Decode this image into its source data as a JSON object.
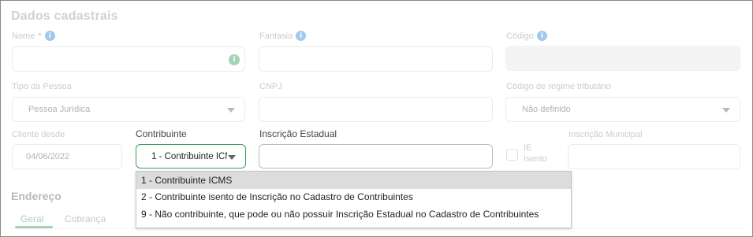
{
  "section_title": "Dados cadastrais",
  "fields": {
    "nome": {
      "label": "Nome",
      "required_mark": "*",
      "value": ""
    },
    "fantasia": {
      "label": "Fantasia",
      "value": ""
    },
    "codigo": {
      "label": "Código",
      "value": ""
    },
    "tipo_pessoa": {
      "label": "Tipo da Pessoa",
      "value": "Pessoa Jurídica"
    },
    "cnpj": {
      "label": "CNPJ",
      "value": ""
    },
    "regime": {
      "label": "Código de regime tributário",
      "value": "Não definido"
    },
    "cliente_desde": {
      "label": "Cliente desde",
      "value": "04/06/2022"
    },
    "contribuinte": {
      "label": "Contribuinte",
      "value": "1 - Contribuinte ICMS"
    },
    "inscricao_estadual": {
      "label": "Inscrição Estadual",
      "value": ""
    },
    "ie_isento": {
      "label_line1": "IE",
      "label_line2": "Isento",
      "checked": false
    },
    "inscricao_municipal": {
      "label": "Inscrição Municipal",
      "value": ""
    }
  },
  "icons": {
    "info": "i",
    "valid": "i"
  },
  "address": {
    "title": "Endereço",
    "tabs": [
      {
        "label": "Geral",
        "active": true
      },
      {
        "label": "Cobrança",
        "active": false
      }
    ]
  },
  "dropdown": {
    "options": [
      {
        "label": "1 - Contribuinte ICMS",
        "selected": true
      },
      {
        "label": "2 - Contribuinte isento de Inscrição no Cadastro de Contribuintes",
        "selected": false
      },
      {
        "label": "9 - Não contribuinte, que pode ou não possuir Inscrição Estadual no Cadastro de Contribuintes",
        "selected": false
      }
    ]
  },
  "colors": {
    "accent_green": "#3a9b5c",
    "info_blue": "#2f8ad8",
    "required_red": "#e04a4a"
  }
}
